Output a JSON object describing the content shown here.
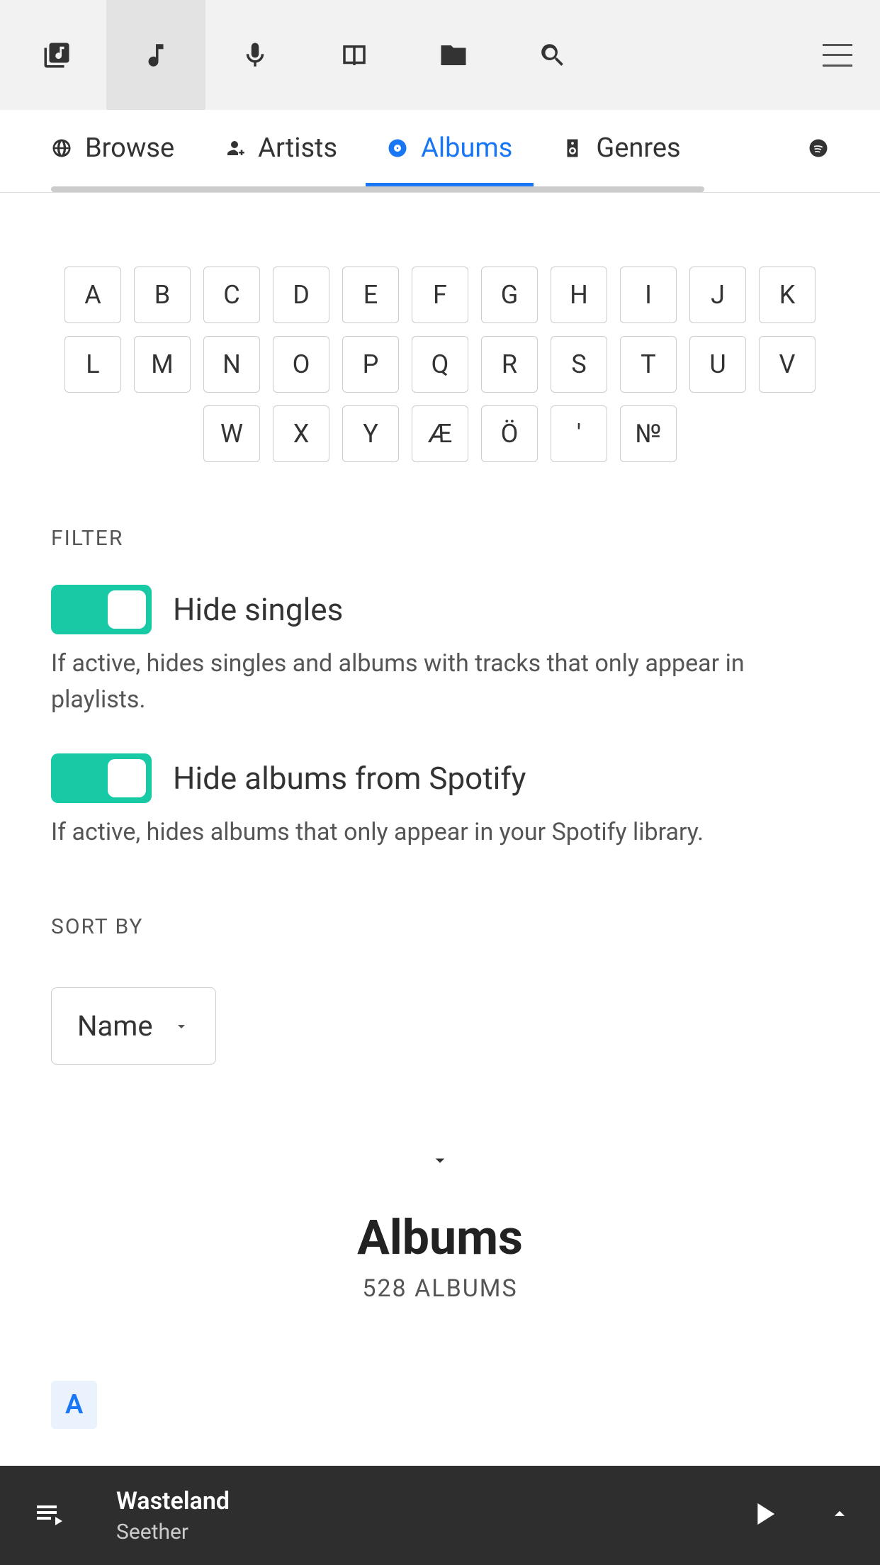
{
  "toolbar": {
    "tabs": [
      "library",
      "music",
      "mic",
      "book",
      "folder",
      "search"
    ],
    "active_index": 1
  },
  "subnav": {
    "browse": "Browse",
    "artists": "Artists",
    "albums": "Albums",
    "genres": "Genres",
    "active": "Albums"
  },
  "alphabet": [
    "A",
    "B",
    "C",
    "D",
    "E",
    "F",
    "G",
    "H",
    "I",
    "J",
    "K",
    "L",
    "M",
    "N",
    "O",
    "P",
    "Q",
    "R",
    "S",
    "T",
    "U",
    "V",
    "W",
    "X",
    "Y",
    "Æ",
    "Ö",
    "'",
    "№"
  ],
  "filter": {
    "heading": "FILTER",
    "hide_singles_label": "Hide singles",
    "hide_singles_desc": "If active, hides singles and albums with tracks that only appear in playlists.",
    "hide_singles_on": true,
    "hide_spotify_label": "Hide albums from Spotify",
    "hide_spotify_desc": "If active, hides albums that only appear in your Spotify library.",
    "hide_spotify_on": true
  },
  "sort": {
    "heading": "SORT BY",
    "selected": "Name"
  },
  "page": {
    "title": "Albums",
    "count_text": "528 ALBUMS",
    "section_letter": "A"
  },
  "now_playing": {
    "title": "Wasteland",
    "artist": "Seether"
  }
}
